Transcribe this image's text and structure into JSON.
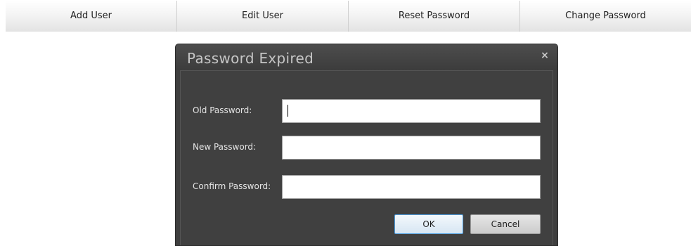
{
  "toolbar": {
    "buttons": [
      {
        "label": "Add User"
      },
      {
        "label": "Edit User"
      },
      {
        "label": "Reset Password"
      },
      {
        "label": "Change Password"
      }
    ]
  },
  "dialog": {
    "title": "Password Expired",
    "close_glyph": "×",
    "close_icon": "close-icon",
    "fields": [
      {
        "label": "Old Password:",
        "value": "",
        "focused": true
      },
      {
        "label": "New Password:",
        "value": ""
      },
      {
        "label": "Confirm Password:",
        "value": ""
      }
    ],
    "ok_label": "OK",
    "cancel_label": "Cancel"
  },
  "colors": {
    "dialog_bg": "#3f3f3f",
    "title_text": "#c6c6c6",
    "label_text": "#e4e4e4",
    "ok_border": "#4f9fe0"
  }
}
